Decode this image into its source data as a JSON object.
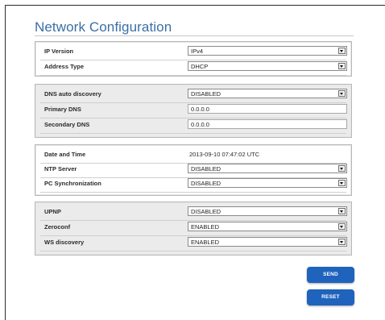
{
  "page": {
    "title": "Network Configuration"
  },
  "sections": [
    {
      "rows": [
        {
          "label": "IP Version",
          "type": "select",
          "value": "IPv4"
        },
        {
          "label": "Address Type",
          "type": "select",
          "value": "DHCP"
        }
      ]
    },
    {
      "rows": [
        {
          "label": "DNS auto discovery",
          "type": "select",
          "value": "DISABLED"
        },
        {
          "label": "Primary DNS",
          "type": "input",
          "value": "0.0.0.0"
        },
        {
          "label": "Secondary DNS",
          "type": "input",
          "value": "0.0.0.0"
        }
      ]
    },
    {
      "rows": [
        {
          "label": "Date and Time",
          "type": "text",
          "value": "2013-09-10 07:47:02 UTC"
        },
        {
          "label": "NTP Server",
          "type": "select",
          "value": "DISABLED"
        },
        {
          "label": "PC Synchronization",
          "type": "select",
          "value": "DISABLED"
        }
      ]
    },
    {
      "rows": [
        {
          "label": "UPNP",
          "type": "select",
          "value": "DISABLED"
        },
        {
          "label": "Zeroconf",
          "type": "select",
          "value": "ENABLED"
        },
        {
          "label": "WS discovery",
          "type": "select",
          "value": "ENABLED"
        }
      ]
    }
  ],
  "buttons": {
    "send": "SEND",
    "reset": "RESET"
  },
  "colors": {
    "title": "#3a6fa6",
    "button": "#1f63bd",
    "panel_grey": "#ebebeb"
  },
  "icons": {
    "dropdown": "chevron-down-icon"
  }
}
